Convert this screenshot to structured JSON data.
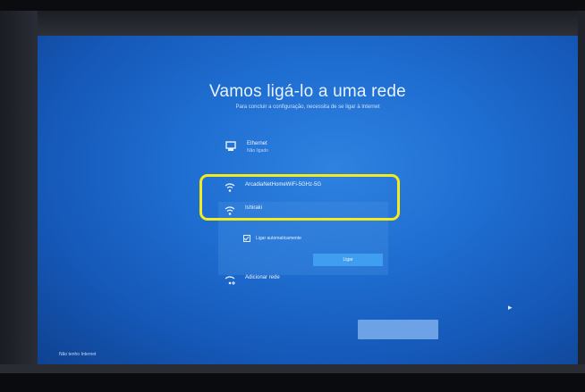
{
  "page": {
    "title": "Vamos ligá-lo a uma rede",
    "subtitle": "Para concluir a configuração, necessita de se ligar à Internet"
  },
  "networks": [
    {
      "icon": "ethernet-icon",
      "name": "Ethernet",
      "status": "Não ligado"
    },
    {
      "icon": "wifi-icon",
      "name": "ArcadiaNetHomeWiFi-5GHz-5G",
      "status": ""
    },
    {
      "icon": "wifi-icon",
      "name": "Ishiraki",
      "status": ""
    },
    {
      "icon": "wifi-icon",
      "name": "Adicionar rede",
      "status": ""
    }
  ],
  "panel": {
    "checkbox_label": "Ligar automaticamente",
    "checkbox_checked": true,
    "connect_label": "Ligar"
  },
  "footer": {
    "skip_label": "Não tenho Internet",
    "next_label": ""
  },
  "colors": {
    "highlight": "#f3ea1f",
    "screen_bg": "#1f6fd2",
    "button_bg": "#3f9ef0"
  }
}
